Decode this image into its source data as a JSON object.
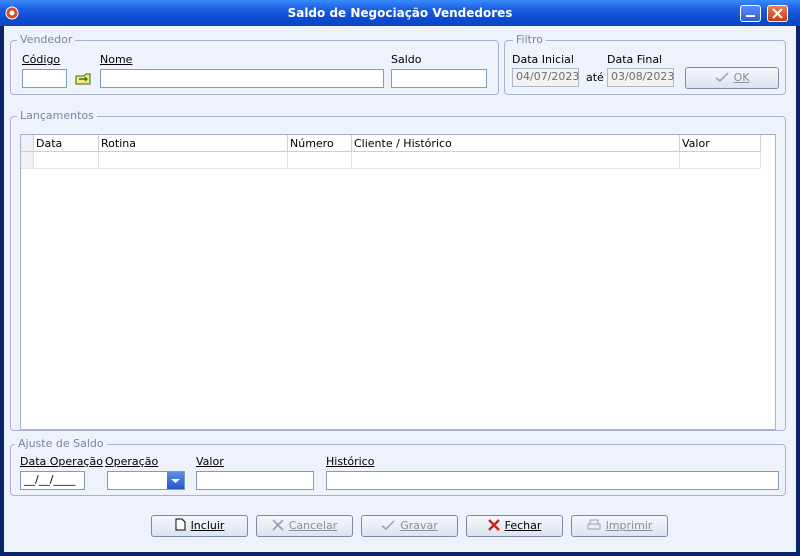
{
  "window": {
    "title": "Saldo de Negociação Vendedores"
  },
  "vendedor": {
    "legend": "Vendedor",
    "codigo_label": "Código",
    "nome_label": "Nome",
    "saldo_label": "Saldo",
    "codigo_value": "",
    "nome_value": "",
    "saldo_value": ""
  },
  "filtro": {
    "legend": "Filtro",
    "data_inicial_label": "Data Inicial",
    "data_final_label": "Data Final",
    "ate_label": "até",
    "data_inicial_value": "04/07/2023",
    "data_final_value": "03/08/2023",
    "ok_label": "OK"
  },
  "lancamentos": {
    "legend": "Lançamentos",
    "columns": [
      "Data",
      "Rotina",
      "Número",
      "Cliente / Histórico",
      "Valor"
    ]
  },
  "ajuste": {
    "legend": "Ajuste de Saldo",
    "data_operacao_label": "Data Operação",
    "operacao_label": "Operação",
    "valor_label": "Valor",
    "historico_label": "Histórico",
    "data_operacao_value": "__/__/____",
    "operacao_value": "",
    "valor_value": "",
    "historico_value": ""
  },
  "buttons": {
    "incluir": "Incluir",
    "cancelar": "Cancelar",
    "gravar": "Gravar",
    "fechar": "Fechar",
    "imprimir": "Imprimir"
  }
}
